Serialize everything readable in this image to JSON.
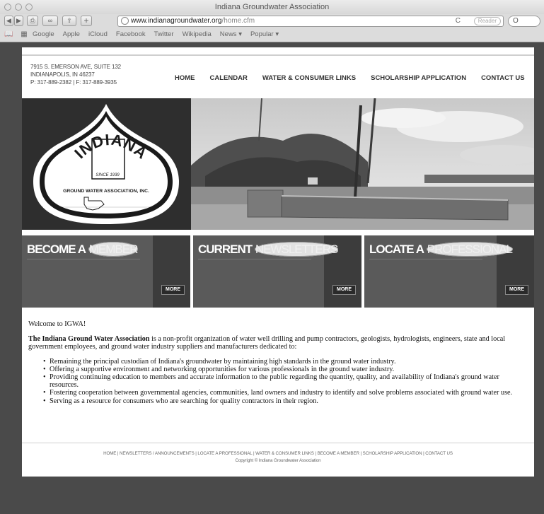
{
  "browser": {
    "window_title": "Indiana Groundwater Association",
    "url_host": "www.indianagroundwater.org",
    "url_path": "/home.cfm",
    "reader_label": "Reader",
    "bookmarks": [
      "Google",
      "Apple",
      "iCloud",
      "Facebook",
      "Twitter",
      "Wikipedia",
      "News ▾",
      "Popular ▾"
    ]
  },
  "header": {
    "address_line1": "7915 S. EMERSON AVE, SUITE 132",
    "address_line2": "INDIANAPOLIS, IN 46237",
    "address_line3": "P: 317-889-2382 | F: 317-889-3935",
    "nav": [
      "HOME",
      "CALENDAR",
      "WATER & CONSUMER LINKS",
      "SCHOLARSHIP APPLICATION",
      "CONTACT US"
    ]
  },
  "logo": {
    "word": "INDIANA",
    "since": "SINCE 1939",
    "org": "GROUND WATER ASSOCIATION, INC."
  },
  "panels": [
    {
      "bold": "BECOME A",
      "light": "MEMBER",
      "more": "MORE"
    },
    {
      "bold": "CURRENT",
      "light": "NEWSLETTERS",
      "more": "MORE"
    },
    {
      "bold": "LOCATE A",
      "light": "PROFESSIONAL",
      "more": "MORE"
    }
  ],
  "content": {
    "welcome": "Welcome to IGWA!",
    "intro_bold": "The Indiana Ground Water Association",
    "intro_rest": " is a non-profit organization of water well drilling and pump contractors, geologists, hydrologists, engineers, state and local government employees, and ground water industry suppliers and manufacturers dedicated to:",
    "bullets": [
      "Remaining the principal custodian of Indiana's groundwater by maintaining high standards in the ground water industry.",
      "Offering a supportive environment and networking opportunities for various professionals in the ground water industry.",
      "Providing continuing education to members and accurate information to the public regarding the quantity, quality, and availability of Indiana's ground water resources.",
      "Fostering cooperation between governmental agencies, communities, land owners and industry to identify and solve problems associated with ground water use.",
      "Serving as a resource for consumers who are searching for quality contractors in their region."
    ]
  },
  "footer": {
    "links": "HOME | NEWSLETTERS / ANNOUNCEMENTS | LOCATE A PROFESSIONAL | WATER & CONSUMER LINKS | BECOME A MEMBER | SCHOLARSHIP APPLICATION | CONTACT US",
    "copyright": "Copyright © Indiana Groundwater Association"
  }
}
